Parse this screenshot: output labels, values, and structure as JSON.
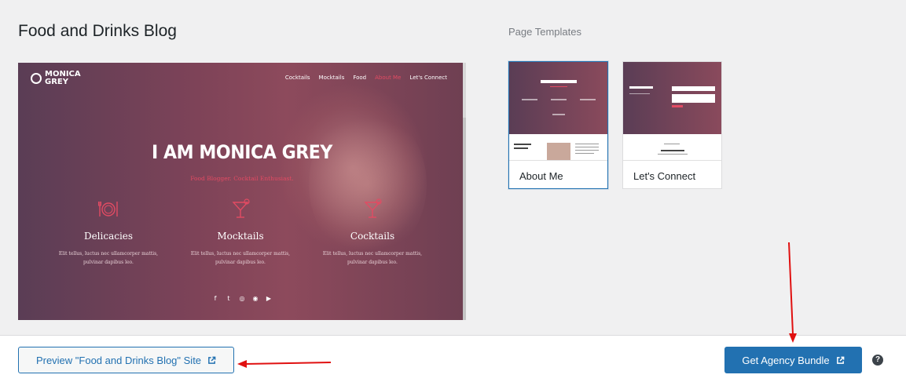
{
  "site": {
    "title": "Food and Drinks Blog"
  },
  "preview_site": {
    "logo_text": "MONICA GREY",
    "nav": [
      "Cocktails",
      "Mocktails",
      "Food",
      "About Me",
      "Let's Connect"
    ],
    "active_nav": "About Me",
    "hero_title": "I AM MONICA GREY",
    "hero_subtitle": "Food Blogger. Cocktail Enthusiast.",
    "features": [
      {
        "title": "Delicacies",
        "text": "Elit tellus, luctus nec ullamcorper mattis, pulvinar dapibus leo.",
        "icon": "plate-cutlery-icon"
      },
      {
        "title": "Mocktails",
        "text": "Elit tellus, luctus nec ullamcorper mattis, pulvinar dapibus leo.",
        "icon": "cocktail-glass-icon"
      },
      {
        "title": "Cocktails",
        "text": "Elit tellus, luctus nec ullamcorper mattis, pulvinar dapibus leo.",
        "icon": "cocktail-glass-icon"
      }
    ],
    "socials": [
      "f",
      "t",
      "◎",
      "◉",
      "▶"
    ],
    "accent_color": "#e24b63"
  },
  "templates": {
    "heading": "Page Templates",
    "items": [
      {
        "label": "About Me",
        "selected": true
      },
      {
        "label": "Let's Connect",
        "selected": false
      }
    ]
  },
  "footer": {
    "preview_button": "Preview \"Food and Drinks Blog\" Site",
    "agency_button": "Get Agency Bundle",
    "help": "?"
  },
  "colors": {
    "primary": "#2271b1",
    "annotation_arrow": "#e01010"
  }
}
